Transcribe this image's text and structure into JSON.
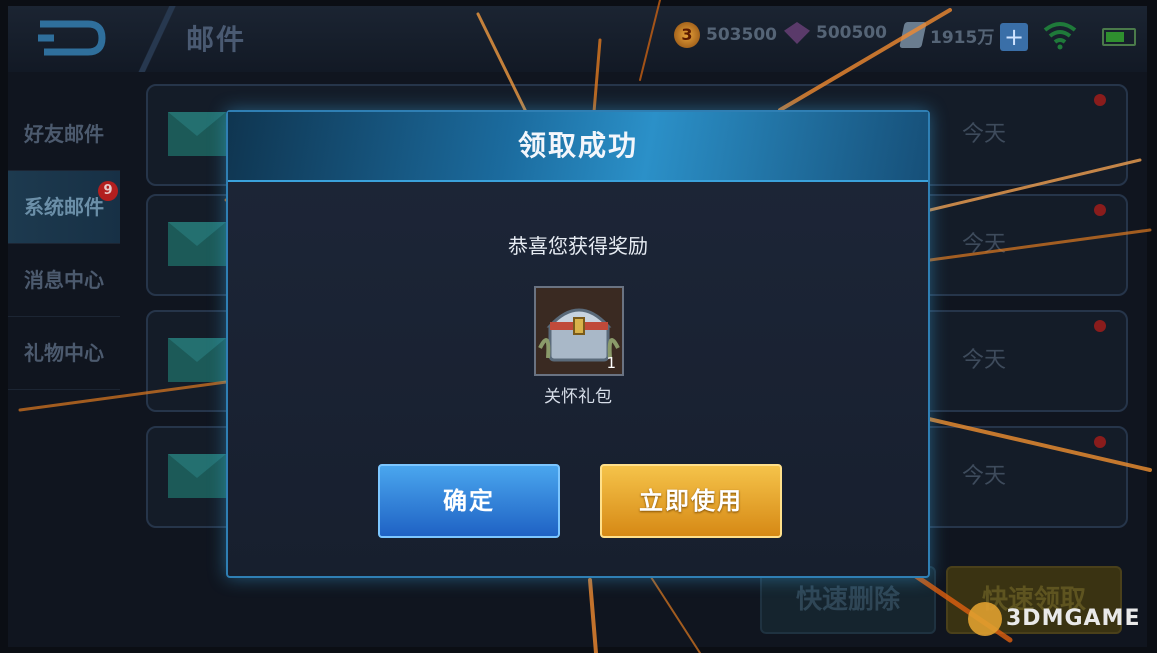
{
  "topbar": {
    "title": "邮件",
    "gold": "503500",
    "diamond": "500500",
    "vouchers": "1915万"
  },
  "sidebar": {
    "items": [
      {
        "label": "好友邮件"
      },
      {
        "label": "系统邮件",
        "badge": "9"
      },
      {
        "label": "消息中心"
      },
      {
        "label": "礼物中心"
      }
    ]
  },
  "mails": [
    {
      "date": "今天"
    },
    {
      "date": "今天"
    },
    {
      "date": "今天"
    },
    {
      "date": "今天"
    }
  ],
  "actions": {
    "delete_label": "快速删除",
    "collect_label": "快速领取"
  },
  "dialog": {
    "title": "领取成功",
    "subtitle": "恭喜您获得奖励",
    "item_name": "关怀礼包",
    "item_count": "1",
    "confirm_label": "确定",
    "use_label": "立即使用"
  },
  "watermark": "3DMGAME",
  "colors": {
    "accent_blue": "#2b90c8",
    "confirm_button": "#1f62c4",
    "use_button": "#d68915"
  }
}
